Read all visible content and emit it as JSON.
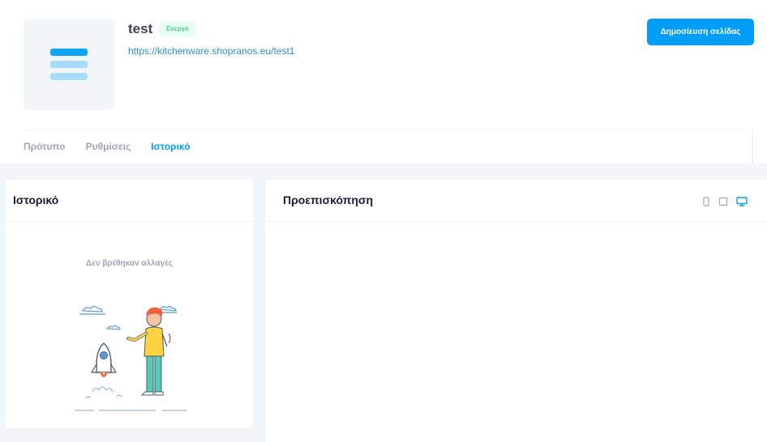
{
  "page": {
    "title": "test",
    "status": "Ενεργό",
    "url": "https://kitchenware.shopranos.eu/test1"
  },
  "actions": {
    "publish_label": "Δημοσίευση σελίδας"
  },
  "tabs": [
    {
      "label": "Πρότυπο",
      "active": false
    },
    {
      "label": "Ρυθμίσεις",
      "active": false
    },
    {
      "label": "Ιστορικό",
      "active": true
    }
  ],
  "history": {
    "title": "Ιστορικό",
    "empty_message": "Δεν βρέθηκαν αλλαγές"
  },
  "preview": {
    "title": "Προεπισκόπηση",
    "devices": [
      {
        "icon": "mobile-icon",
        "active": false
      },
      {
        "icon": "tablet-icon",
        "active": false
      },
      {
        "icon": "desktop-icon",
        "active": true
      }
    ]
  },
  "colors": {
    "primary": "#009ef7",
    "success_bg": "#e8fff3",
    "success_text": "#50cd89",
    "muted": "#a1a5b7"
  }
}
